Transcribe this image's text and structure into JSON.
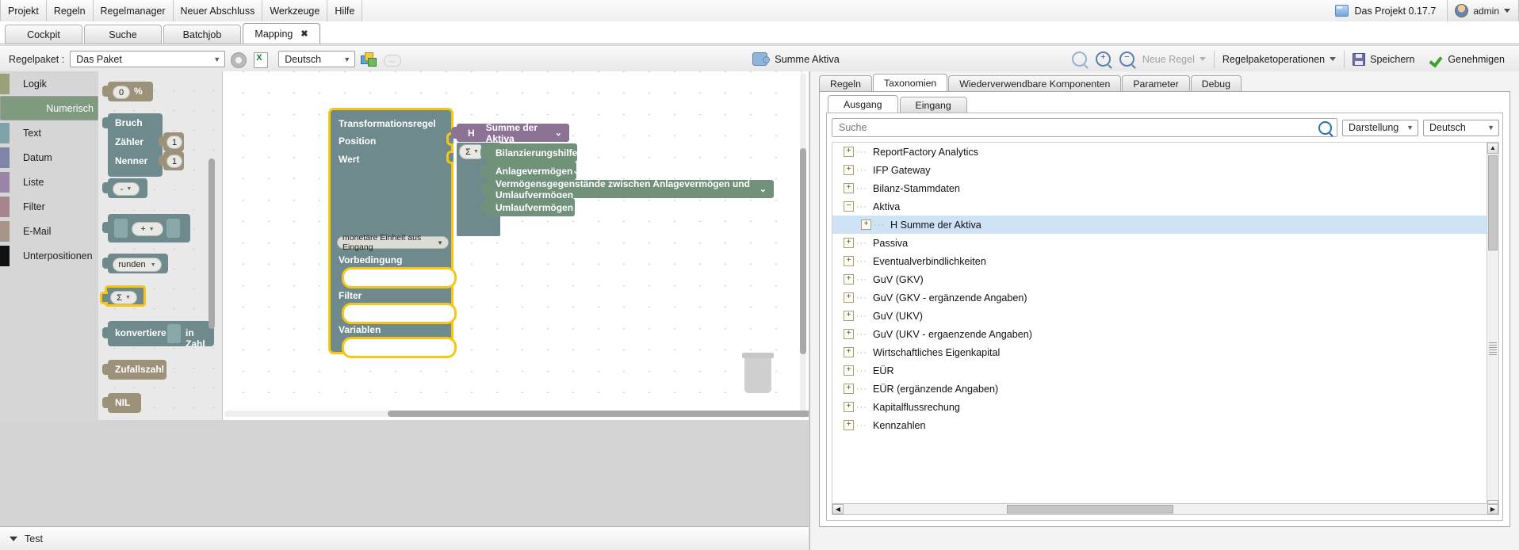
{
  "menubar": {
    "items": [
      "Projekt",
      "Regeln",
      "Regelmanager",
      "Neuer Abschluss",
      "Werkzeuge",
      "Hilfe"
    ],
    "project_label": "Das Projekt 0.17.7",
    "user": "admin",
    "folder_icon": "folder-icon",
    "avatar_icon": "avatar-icon"
  },
  "tabs": [
    {
      "label": "Cockpit",
      "active": false,
      "closable": false
    },
    {
      "label": "Suche",
      "active": false,
      "closable": false
    },
    {
      "label": "Batchjob",
      "active": false,
      "closable": false
    },
    {
      "label": "Mapping",
      "active": true,
      "closable": true,
      "close_glyph": "✖"
    }
  ],
  "toolbar": {
    "package_label": "Regelpaket :",
    "package_value": "Das Paket",
    "language_value": "Deutsch",
    "gear_icon": "gear-icon",
    "excel_icon": "excel-export-icon",
    "translate_icon": "translate-icon",
    "comment_icon": "comment-icon",
    "center_title": "Summe Aktiva",
    "center_icon": "puzzle-icon",
    "zoom_reset_icon": "zoom-reset-icon",
    "zoom_in_icon": "zoom-in-icon",
    "zoom_out_icon": "zoom-out-icon",
    "zoom_in_glyph": "+",
    "zoom_out_glyph": "−",
    "new_rule": "Neue Regel",
    "package_ops": "Regelpaketoperationen",
    "save": "Speichern",
    "approve": "Genehmigen"
  },
  "rail": {
    "items": [
      {
        "label": "Logik",
        "color": "#9aa07a",
        "selected": false
      },
      {
        "label": "Numerisch",
        "color": "#7e9b80",
        "selected": true
      },
      {
        "label": "Text",
        "color": "#7fa3a8",
        "selected": false
      },
      {
        "label": "Datum",
        "color": "#7e85a8",
        "selected": false
      },
      {
        "label": "Liste",
        "color": "#9a85a8",
        "selected": false
      },
      {
        "label": "Filter",
        "color": "#a8848f",
        "selected": false
      },
      {
        "label": "E-Mail",
        "color": "#a89484",
        "selected": false
      },
      {
        "label": "Unterpositionen",
        "color": "#111111",
        "selected": false
      }
    ]
  },
  "palette": {
    "percent_block": {
      "value": "0",
      "unit": "%"
    },
    "fraction_block": {
      "title": "Bruch",
      "numerator_label": "Zähler",
      "numerator_value": "1",
      "denominator_label": "Nenner",
      "denominator_value": "1"
    },
    "minus_block": {
      "op": "-"
    },
    "plus_block": {
      "op": "+"
    },
    "round_block": {
      "label": "runden"
    },
    "sum_block": {
      "op": "Σ",
      "selected": true
    },
    "convert_block": {
      "label_left": "konvertiere",
      "label_right": "in Zahl"
    },
    "random_block": {
      "label": "Zufallszahl"
    },
    "nil_block": {
      "label": "NIL"
    }
  },
  "canvas": {
    "rule_block": {
      "title": "Transformationsregel",
      "position_label": "Position",
      "value_label": "Wert",
      "unit_chip": "monetäre Einheit aus Eingang",
      "precondition_label": "Vorbedingung",
      "filter_label": "Filter",
      "variables_label": "Variablen"
    },
    "position_block": {
      "prefix": "H",
      "label": "Summe der Aktiva",
      "chevron": "⌄"
    },
    "sum_chip": {
      "op": "Σ"
    },
    "value_blocks": [
      {
        "label": "Bilanzierungshilfe",
        "chevron": "⌄"
      },
      {
        "label": "Anlagevermögen",
        "chevron": "⌄"
      },
      {
        "label": "Vermögensgegenstände zwischen Anlagevermögen und Umlaufvermögen",
        "chevron": "⌄"
      },
      {
        "label": "Umlaufvermögen",
        "chevron": "⌄"
      }
    ],
    "trash_icon": "trash-icon"
  },
  "bottom": {
    "test_label": "Test",
    "chevron": "chevron-down-icon"
  },
  "right_panel": {
    "tabs": [
      {
        "label": "Regeln",
        "active": false
      },
      {
        "label": "Taxonomien",
        "active": true
      },
      {
        "label": "Wiederverwendbare Komponenten",
        "active": false
      },
      {
        "label": "Parameter",
        "active": false
      },
      {
        "label": "Debug",
        "active": false
      }
    ],
    "subtabs": [
      {
        "label": "Ausgang",
        "active": true
      },
      {
        "label": "Eingang",
        "active": false
      }
    ],
    "search_placeholder": "Suche",
    "search_value": "",
    "search_icon": "search-icon",
    "display_select": "Darstellung",
    "language_select": "Deutsch",
    "tree": [
      {
        "label": "ReportFactory Analytics",
        "depth": 0,
        "expander": "+",
        "selected": false
      },
      {
        "label": "IFP Gateway",
        "depth": 0,
        "expander": "+",
        "selected": false
      },
      {
        "label": "Bilanz-Stammdaten",
        "depth": 0,
        "expander": "+",
        "selected": false
      },
      {
        "label": "Aktiva",
        "depth": 0,
        "expander": "−",
        "selected": false
      },
      {
        "label": "H Summe der Aktiva",
        "depth": 1,
        "expander": "+",
        "selected": true
      },
      {
        "label": "Passiva",
        "depth": 0,
        "expander": "+",
        "selected": false
      },
      {
        "label": "Eventualverbindlichkeiten",
        "depth": 0,
        "expander": "+",
        "selected": false
      },
      {
        "label": "GuV (GKV)",
        "depth": 0,
        "expander": "+",
        "selected": false
      },
      {
        "label": "GuV (GKV - ergänzende Angaben)",
        "depth": 0,
        "expander": "+",
        "selected": false
      },
      {
        "label": "GuV (UKV)",
        "depth": 0,
        "expander": "+",
        "selected": false
      },
      {
        "label": "GuV (UKV - ergaenzende Angaben)",
        "depth": 0,
        "expander": "+",
        "selected": false
      },
      {
        "label": "Wirtschaftliches Eigenkapital",
        "depth": 0,
        "expander": "+",
        "selected": false
      },
      {
        "label": "EÜR",
        "depth": 0,
        "expander": "+",
        "selected": false
      },
      {
        "label": "EÜR (ergänzende Angaben)",
        "depth": 0,
        "expander": "+",
        "selected": false
      },
      {
        "label": "Kapitalflussrechung",
        "depth": 0,
        "expander": "+",
        "selected": false
      },
      {
        "label": "Kennzahlen",
        "depth": 0,
        "expander": "+",
        "selected": false
      }
    ]
  }
}
